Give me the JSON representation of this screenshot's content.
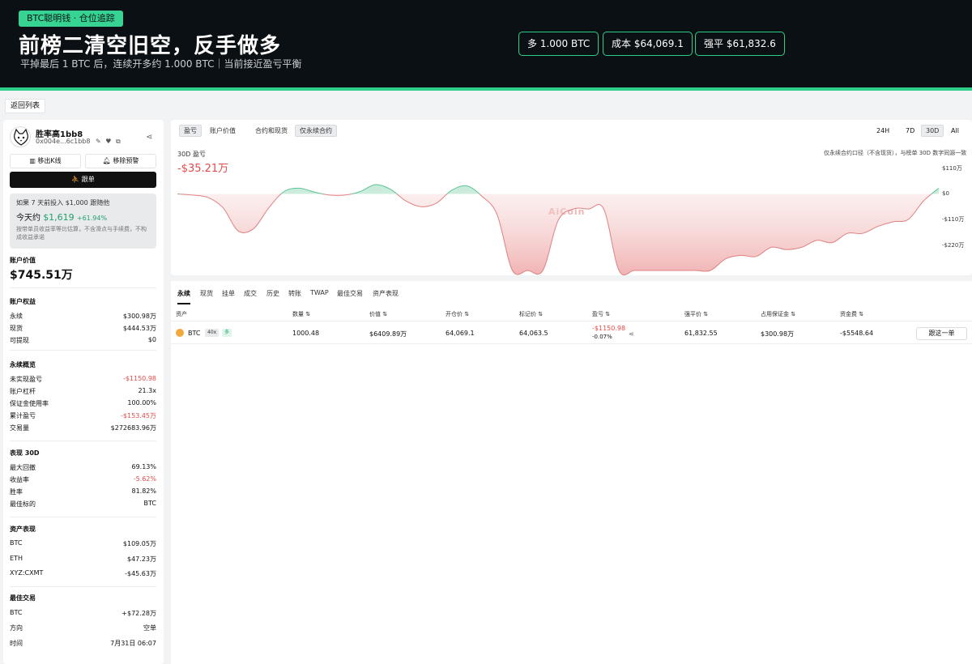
{
  "banner": {
    "tag": "BTC聪明钱 ·  仓位追踪",
    "title": "前榜二清空旧空，反手做多",
    "subtitle": "平掉最后 1 BTC 后，连续开多约 1.000 BTC｜当前接近盈亏平衡",
    "pills": [
      "多  1.000 BTC",
      "成本  $64,069.1",
      "强平  $61,832.6"
    ]
  },
  "toolbar": {
    "back_label": "返回列表"
  },
  "trader": {
    "name": "胜率高1bb8",
    "address": "0x004e...6c1bb8",
    "kline_label": "移出K线",
    "alert_label": "移除预警",
    "follow_label": "跟单"
  },
  "sim": {
    "line1": "如果 7 天前投入 $1,000 跟随他",
    "today_label": "今天约",
    "today_value": "$1,619",
    "today_pct": "+61.94%",
    "note": "按带单员收益率等比估算，不含滑点与手续费，不构成收益承诺"
  },
  "account": {
    "value_title": "账户价值",
    "value": "$745.51万",
    "equity_title": "账户权益",
    "equity": [
      {
        "k": "永续",
        "v": "$300.98万"
      },
      {
        "k": "现货",
        "v": "$444.53万"
      },
      {
        "k": "可提现",
        "v": "$0"
      }
    ],
    "perp_title": "永续概览",
    "perp": [
      {
        "k": "未实现盈亏",
        "v": "-$1150.98"
      },
      {
        "k": "账户杠杆",
        "v": "21.3x"
      },
      {
        "k": "保证金使用率",
        "v": "100.00%"
      },
      {
        "k": "累计盈亏",
        "v": "-$153.45万"
      },
      {
        "k": "交易量",
        "v": "$272683.96万"
      }
    ],
    "perf_title": "表现 30D",
    "perf": [
      {
        "k": "最大回撤",
        "v": "69.13%"
      },
      {
        "k": "收益率",
        "v": "-5.62%"
      },
      {
        "k": "胜率",
        "v": "81.82%"
      },
      {
        "k": "最佳标的",
        "v": "BTC"
      }
    ],
    "asset_title": "资产表现",
    "assets": [
      {
        "k": "BTC",
        "v": "$109.05万"
      },
      {
        "k": "ETH",
        "v": "$47.23万"
      },
      {
        "k": "XYZ:CXMT",
        "v": "-$45.63万"
      }
    ],
    "best_title": "最佳交易",
    "best": [
      {
        "k": "BTC",
        "v": "+$72.28万"
      },
      {
        "k": "方向",
        "v": "空单"
      },
      {
        "k": "时间",
        "v": "7月31日 06:07"
      }
    ]
  },
  "chart_controls": {
    "left": [
      "盈亏",
      "账户价值"
    ],
    "right": [
      "合约和现货",
      "仅永续合约"
    ],
    "ranges": [
      "24H",
      "7D",
      "30D",
      "All"
    ]
  },
  "chart_header": {
    "caption": "30D 盈亏",
    "total": "-$35.21万",
    "note": "仅永续合约口径（不含现货），与榜单 30D 数字同源一致",
    "watermark": "AiCoin"
  },
  "chart_data": {
    "type": "area",
    "title": "30D 盈亏",
    "ylabel": "",
    "y_tick_labels": [
      "$110万",
      "$0",
      "-$110万",
      "-$220万"
    ],
    "y_ticks": [
      110,
      0,
      -110,
      -220
    ],
    "ylim": [
      -330,
      110
    ],
    "x": [
      0,
      1,
      2,
      3,
      4,
      5,
      6,
      7,
      8,
      9,
      10,
      11,
      12,
      13,
      14,
      15,
      16,
      17,
      18,
      19,
      20,
      21,
      22,
      23,
      24,
      25,
      26,
      27,
      28,
      29,
      30,
      31,
      32,
      33,
      34,
      35,
      36,
      37,
      38,
      39,
      40,
      41,
      42,
      43,
      44,
      45,
      46,
      47,
      48,
      49,
      50
    ],
    "values": [
      0,
      -5,
      -15,
      -60,
      -160,
      -150,
      -60,
      10,
      25,
      8,
      -5,
      -5,
      10,
      40,
      20,
      -30,
      -55,
      -40,
      15,
      35,
      -10,
      -90,
      -330,
      -330,
      -330,
      -115,
      -65,
      -65,
      -65,
      -330,
      -330,
      -330,
      -330,
      -330,
      -330,
      -330,
      -280,
      -265,
      -270,
      -230,
      -240,
      -230,
      -200,
      -210,
      -170,
      -170,
      -140,
      -120,
      -110,
      -30,
      25
    ],
    "series": [
      {
        "name": "",
        "values_ref": "values"
      }
    ],
    "grid": false
  },
  "positions": {
    "tabs": [
      "永续",
      "现货",
      "挂单",
      "成交",
      "历史",
      "转账",
      "TWAP",
      "最佳交易",
      "资产表现"
    ],
    "columns": [
      "资产",
      "数量 ⇅",
      "价值 ⇅",
      "开仓价 ⇅",
      "标记价 ⇅",
      "盈亏 ⇅",
      "强平价 ⇅",
      "占用保证金 ⇅",
      "资金费 ⇅"
    ],
    "rows": [
      {
        "asset": "BTC",
        "leverage": "40x",
        "side": "多",
        "qty": "1000.48",
        "value": "$6409.89万",
        "entry": "64,069.1",
        "mark": "64,063.5",
        "pnl": "-$1150.98",
        "pnl_pct": "-0.07%",
        "liq": "61,832.55",
        "margin": "$300.98万",
        "funding": "-$5548.64",
        "action": "跟这一单"
      }
    ]
  },
  "colors": {
    "accent": "#2fcf8a",
    "negative": "#e24b4b",
    "positive": "#22a06b"
  }
}
